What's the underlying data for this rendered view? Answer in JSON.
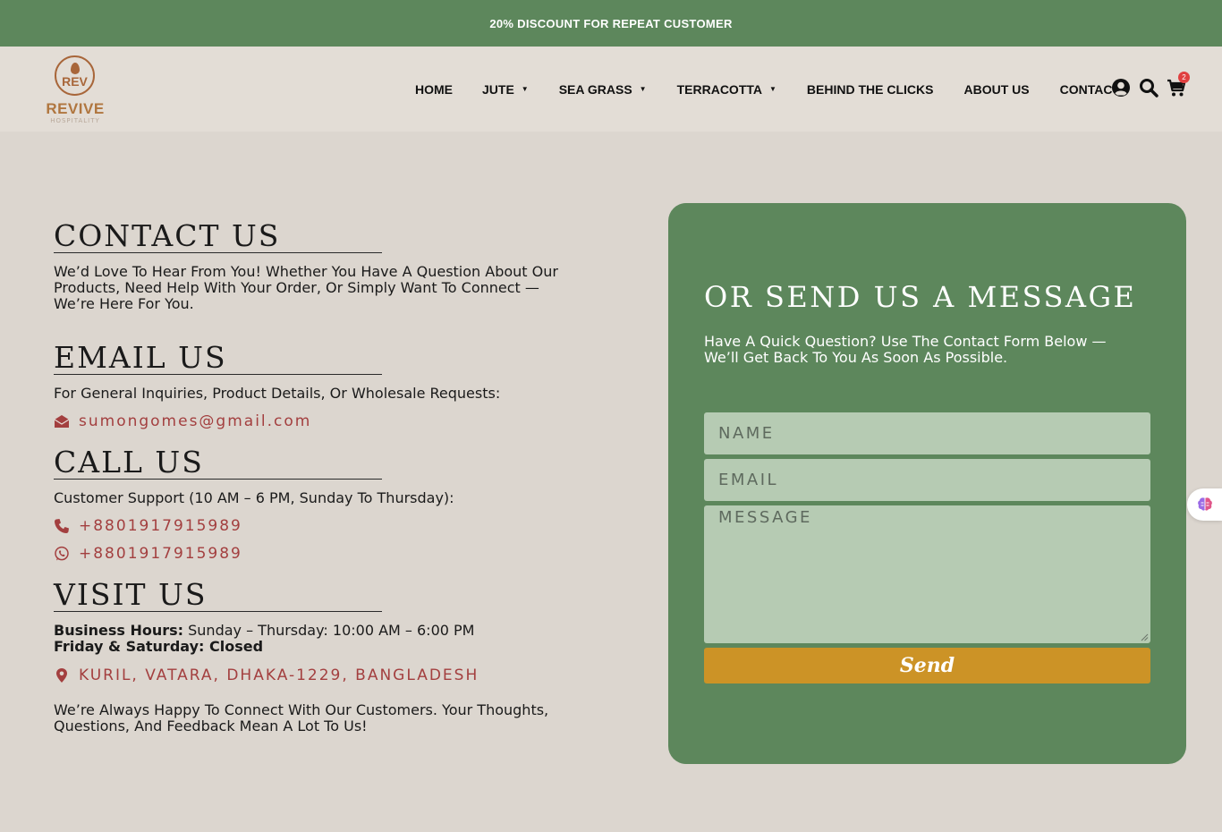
{
  "promo_bar": {
    "text": "20% DISCOUNT FOR REPEAT CUSTOMER"
  },
  "logo": {
    "mark": "REV",
    "name": "REVIVE",
    "tagline": "HOSPITALITY"
  },
  "nav": [
    {
      "label": "HOME",
      "has_dropdown": false
    },
    {
      "label": "JUTE",
      "has_dropdown": true
    },
    {
      "label": "SEA GRASS",
      "has_dropdown": true
    },
    {
      "label": "TERRACOTTA",
      "has_dropdown": true
    },
    {
      "label": "BEHIND THE CLICKS",
      "has_dropdown": false
    },
    {
      "label": "ABOUT US",
      "has_dropdown": false
    },
    {
      "label": "CONTACT",
      "has_dropdown": false
    }
  ],
  "header_icons": {
    "account": "user-circle-icon",
    "search": "search-icon",
    "cart": "cart-icon",
    "cart_count": "2"
  },
  "contact": {
    "title": "CONTACT US",
    "text": "We’d Love To Hear From You! Whether You Have A Question About Our Products, Need Help With Your Order, Or Simply Want To Connect — We’re Here For You."
  },
  "email": {
    "title": "EMAIL US",
    "text": "For General Inquiries, Product Details, Or Wholesale Requests:",
    "address": "sumongomes@gmail.com",
    "icon": "envelope-icon"
  },
  "call": {
    "title": "CALL US",
    "text": "Customer Support (10 AM – 6 PM, Sunday To Thursday):",
    "phone": "+8801917915989",
    "phone_icon": "phone-icon",
    "whatsapp": "+8801917915989",
    "whatsapp_icon": "whatsapp-icon"
  },
  "visit": {
    "title": "VISIT US",
    "hours_label": "Business Hours:",
    "hours_value": " Sunday – Thursday: 10:00 AM – 6:00 PM",
    "closed_line": "Friday & Saturday: Closed",
    "address": "KURIL, VATARA, DHAKA-1229, BANGLADESH",
    "address_icon": "map-pin-icon",
    "closing_text": "We’re Always Happy To Connect With Our Customers. Your Thoughts, Questions, And Feedback Mean A Lot To Us!"
  },
  "form": {
    "title": "OR SEND US A MESSAGE",
    "text": "Have A Quick Question? Use The Contact Form Below — We’ll Get Back To You As Soon As Possible.",
    "name_placeholder": "NAME",
    "email_placeholder": "EMAIL",
    "message_placeholder": "MESSAGE",
    "send_label": "Send"
  },
  "colors": {
    "brand_green": "#5d875c",
    "field_green": "#b6cbb3",
    "send_gold": "#cc9326",
    "link_red": "#a33f3f",
    "logo_brown": "#a8663a"
  }
}
